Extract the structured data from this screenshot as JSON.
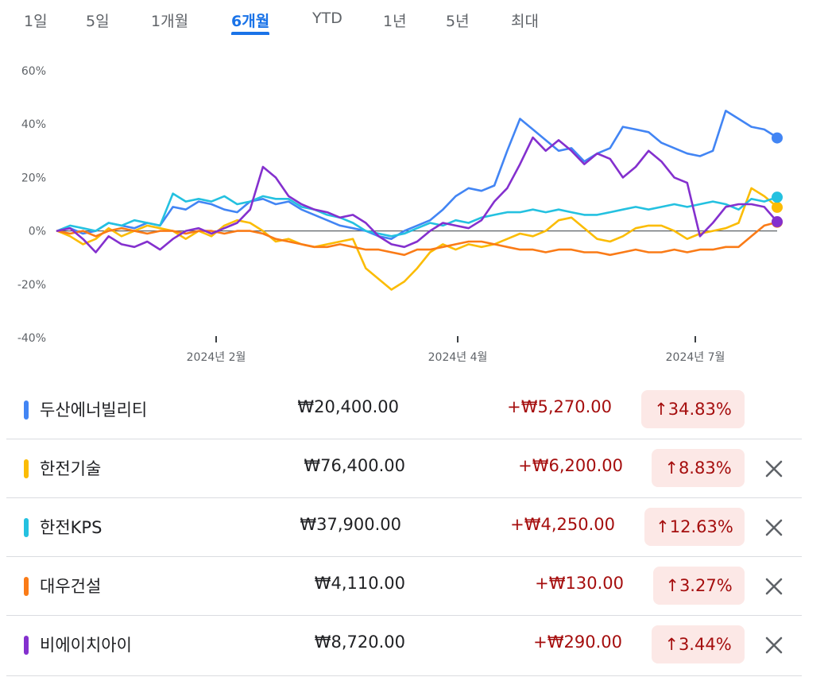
{
  "tabs": [
    {
      "label": "1일",
      "active": false
    },
    {
      "label": "5일",
      "active": false
    },
    {
      "label": "1개월",
      "active": false
    },
    {
      "label": "6개월",
      "active": true
    },
    {
      "label": "YTD",
      "active": false
    },
    {
      "label": "1년",
      "active": false
    },
    {
      "label": "5년",
      "active": false
    },
    {
      "label": "최대",
      "active": false
    }
  ],
  "chart_data": {
    "type": "line",
    "ylim": [
      -40,
      60
    ],
    "yticks": [
      60,
      40,
      20,
      0,
      -20,
      -40
    ],
    "ytick_labels": [
      "60%",
      "40%",
      "20%",
      "0%",
      "-20%",
      "-40%"
    ],
    "xtick_labels": [
      "2024년 2월",
      "2024년 4월",
      "2024년 7월"
    ],
    "baseline": 0,
    "grid": false,
    "series": [
      {
        "name": "두산에너빌리티",
        "color": "#4285f4",
        "end_value": 34.83,
        "values": [
          0,
          1,
          -1,
          0,
          3,
          2,
          1,
          3,
          2,
          9,
          8,
          11,
          10,
          8,
          7,
          11,
          12,
          10,
          11,
          8,
          6,
          4,
          2,
          1,
          0,
          -2,
          -3,
          0,
          2,
          4,
          8,
          13,
          16,
          15,
          17,
          30,
          42,
          38,
          34,
          30,
          31,
          26,
          29,
          31,
          39,
          38,
          37,
          33,
          31,
          29,
          28,
          30,
          45,
          42,
          39,
          38,
          35
        ]
      },
      {
        "name": "한전기술",
        "color": "#fbbc04",
        "end_value": 8.83,
        "values": [
          0,
          -2,
          -5,
          -3,
          1,
          -2,
          0,
          2,
          1,
          0,
          -3,
          0,
          -2,
          2,
          4,
          3,
          0,
          -4,
          -3,
          -5,
          -6,
          -5,
          -4,
          -3,
          -14,
          -18,
          -22,
          -19,
          -14,
          -8,
          -5,
          -7,
          -5,
          -6,
          -5,
          -3,
          -1,
          -2,
          0,
          4,
          5,
          1,
          -3,
          -4,
          -2,
          1,
          2,
          2,
          0,
          -3,
          -1,
          0,
          1,
          3,
          16,
          13,
          9
        ]
      },
      {
        "name": "한전KPS",
        "color": "#24c1e0",
        "end_value": 12.63,
        "values": [
          0,
          2,
          1,
          0,
          3,
          2,
          4,
          3,
          2,
          14,
          11,
          12,
          11,
          13,
          10,
          11,
          13,
          12,
          12,
          9,
          8,
          6,
          5,
          3,
          0,
          -1,
          -2,
          -1,
          1,
          3,
          2,
          4,
          3,
          5,
          6,
          7,
          7,
          8,
          7,
          8,
          7,
          6,
          6,
          7,
          8,
          9,
          8,
          9,
          10,
          9,
          10,
          11,
          10,
          8,
          12,
          11,
          12.63
        ]
      },
      {
        "name": "대우건설",
        "color": "#fa7b17",
        "end_value": 3.27,
        "values": [
          0,
          -1,
          0,
          -2,
          0,
          1,
          0,
          -1,
          0,
          0,
          -1,
          0,
          0,
          -1,
          0,
          0,
          -1,
          -3,
          -4,
          -5,
          -6,
          -6,
          -5,
          -6,
          -7,
          -7,
          -8,
          -9,
          -7,
          -7,
          -6,
          -5,
          -4,
          -4,
          -5,
          -6,
          -7,
          -7,
          -8,
          -7,
          -7,
          -8,
          -8,
          -9,
          -8,
          -7,
          -8,
          -8,
          -7,
          -8,
          -7,
          -7,
          -6,
          -6,
          -2,
          2,
          3.27
        ]
      },
      {
        "name": "비에이치아이",
        "color": "#8430ce",
        "end_value": 3.44,
        "values": [
          0,
          1,
          -3,
          -8,
          -2,
          -5,
          -6,
          -4,
          -7,
          -3,
          0,
          1,
          -1,
          1,
          3,
          8,
          24,
          20,
          13,
          10,
          8,
          7,
          5,
          6,
          3,
          -2,
          -5,
          -6,
          -4,
          0,
          3,
          2,
          1,
          4,
          11,
          16,
          25,
          35,
          30,
          34,
          30,
          25,
          29,
          27,
          20,
          24,
          30,
          26,
          20,
          18,
          -2,
          3,
          9,
          10,
          10,
          9,
          3.44
        ]
      }
    ]
  },
  "stocks": [
    {
      "name": "두산에너빌리티",
      "color": "#4285f4",
      "price": "₩20,400.00",
      "change": "+₩5,270.00",
      "pct": "↑34.83%",
      "removable": false
    },
    {
      "name": "한전기술",
      "color": "#fbbc04",
      "price": "₩76,400.00",
      "change": "+₩6,200.00",
      "pct": "↑8.83%",
      "removable": true
    },
    {
      "name": "한전KPS",
      "color": "#24c1e0",
      "price": "₩37,900.00",
      "change": "+₩4,250.00",
      "pct": "↑12.63%",
      "removable": true
    },
    {
      "name": "대우건설",
      "color": "#fa7b17",
      "price": "₩4,110.00",
      "change": "+₩130.00",
      "pct": "↑3.27%",
      "removable": true
    },
    {
      "name": "비에이치아이",
      "color": "#8430ce",
      "price": "₩8,720.00",
      "change": "+₩290.00",
      "pct": "↑3.44%",
      "removable": true
    }
  ],
  "icons": {
    "remove": "close-icon"
  }
}
